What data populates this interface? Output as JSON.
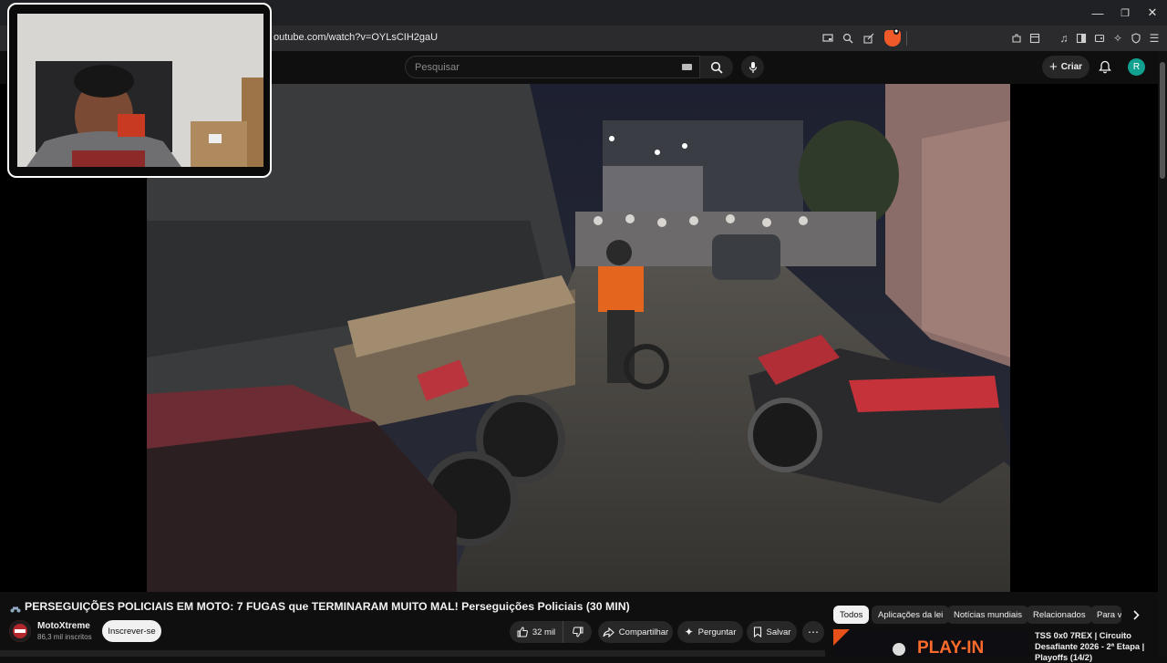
{
  "browser": {
    "url": "outube.com/watch?v=OYLsCIH2gaU",
    "window_controls": [
      "—",
      "❐",
      "✕"
    ]
  },
  "youtube": {
    "search_placeholder": "Pesquisar",
    "create_label": "Criar",
    "avatar_letter": "R"
  },
  "video": {
    "title": "PERSEGUIÇÕES POLICIAIS EM MOTO: 7 FUGAS que TERMINARAM MUITO MAL! Perseguições Policiais (30 MIN)",
    "channel_name": "MotoXtreme",
    "channel_subs": "86,3 mil inscritos",
    "subscribe_label": "Inscrever-se",
    "likes": "32 mil",
    "share_label": "Compartilhar",
    "ask_label": "Perguntar",
    "save_label": "Salvar",
    "more_label": "⋯"
  },
  "chips": [
    "Todos",
    "Aplicações da lei",
    "Notícias mundiais",
    "Relacionados",
    "Para v"
  ],
  "recommendation": {
    "thumb_text": "PLAY-IN",
    "title": "TSS 0x0 7REX | Circuito Desafiante 2026 - 2ª Etapa | Playoffs (14/2)"
  }
}
